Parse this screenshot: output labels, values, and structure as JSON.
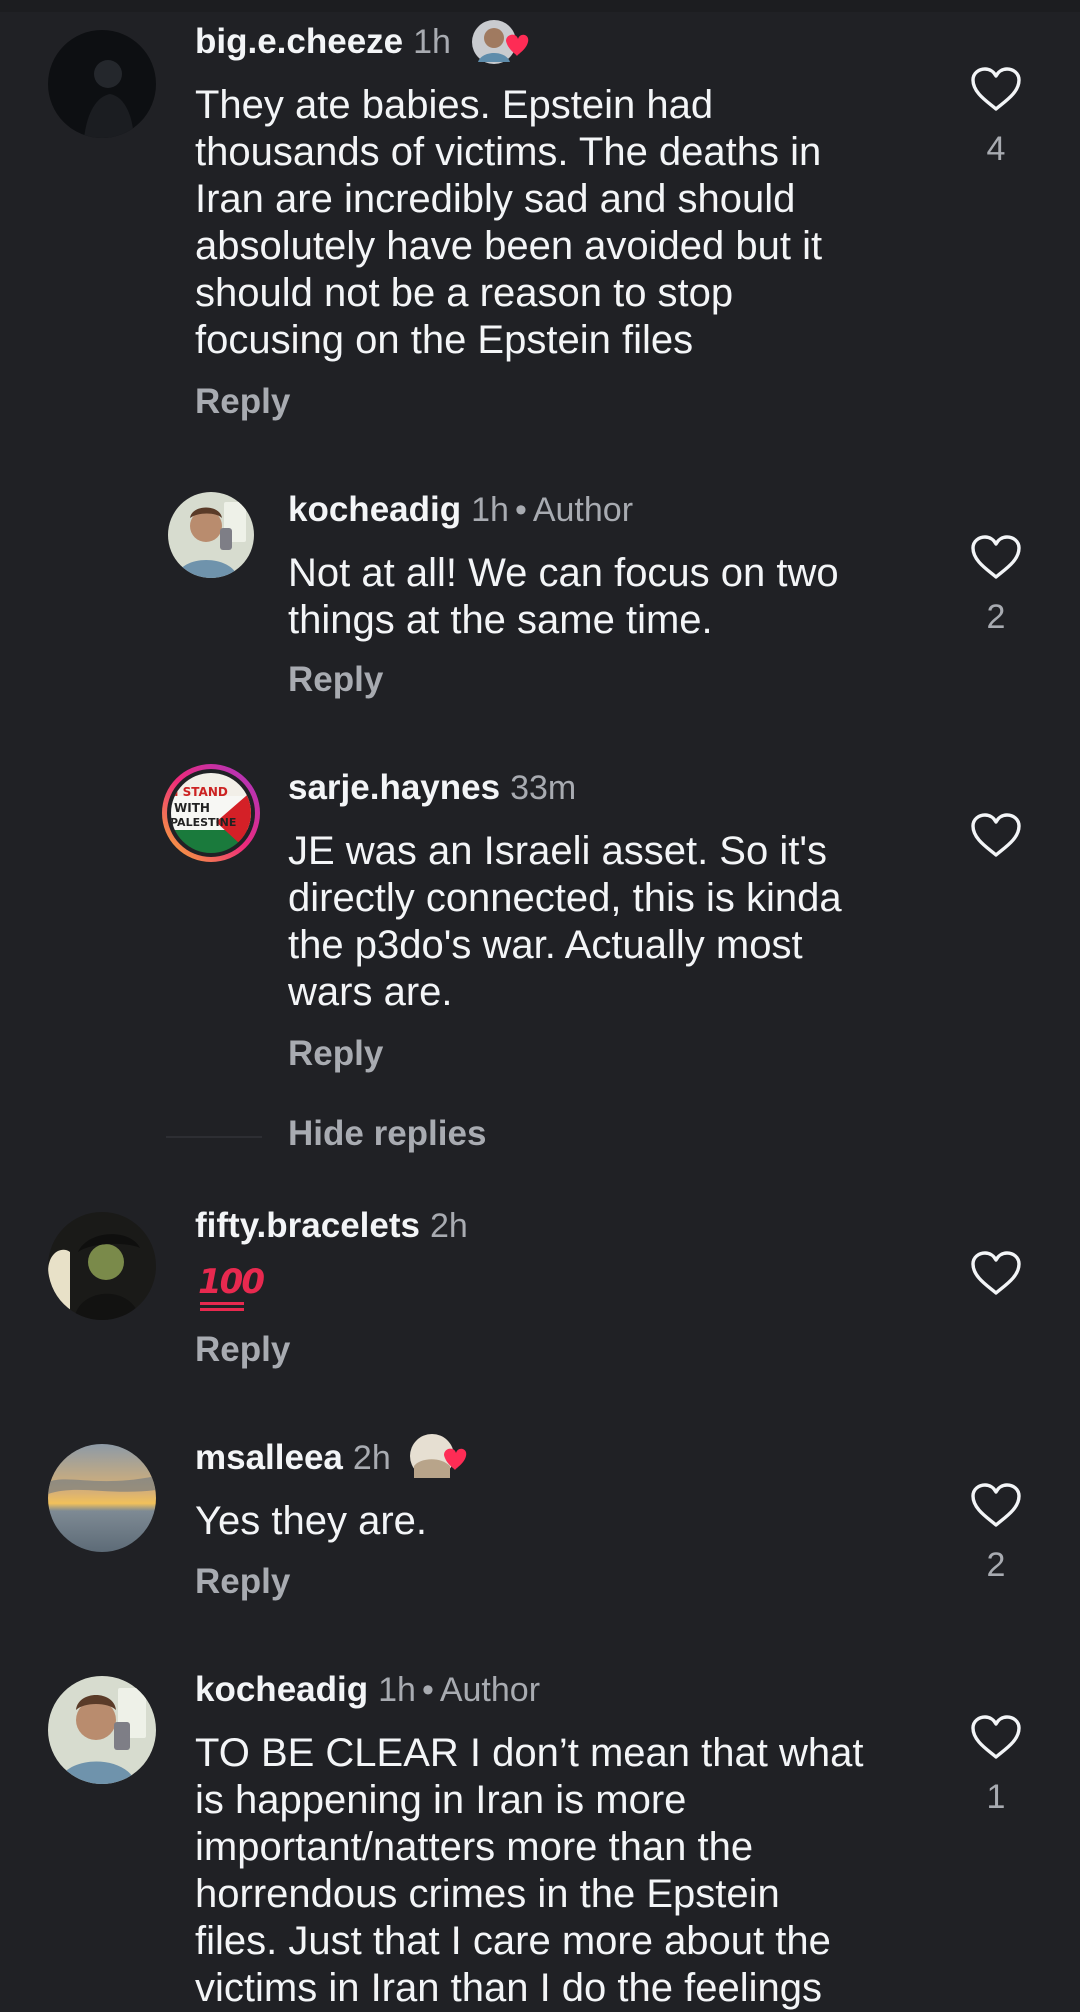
{
  "comments": [
    {
      "username": "big.e.cheeze",
      "time": "1h",
      "author_badge": "",
      "text": "They ate babies. Epstein had thousands of victims. The deaths in Iran are incredibly sad and should absolutely have been avoided but it should not be a reason to stop focusing on the Epstein files",
      "lines": [
        "They ate babies. Epstein had",
        "thousands of victims. The deaths in",
        "Iran are incredibly sad and should",
        "absolutely have been avoided but it",
        "should not be a reason to stop",
        "focusing on the Epstein files"
      ],
      "reply_label": "Reply",
      "likes": "4",
      "liked_by_author": true
    },
    {
      "username": "kocheadig",
      "time": "1h",
      "author_badge": "Author",
      "separator": "•",
      "lines": [
        "Not at all! We can focus on two",
        "things at the same time."
      ],
      "reply_label": "Reply",
      "likes": "2"
    },
    {
      "username": "sarje.haynes",
      "time": "33m",
      "avatar_text": [
        "I STAND",
        "WITH",
        "PALESTINE"
      ],
      "lines": [
        "JE was an Israeli asset. So it's",
        "directly connected, this is kinda",
        "the p3do's war. Actually most",
        "wars are."
      ],
      "reply_label": "Reply",
      "likes": ""
    },
    {
      "username": "fifty.bracelets",
      "time": "2h",
      "emoji_text": "100",
      "reply_label": "Reply",
      "likes": ""
    },
    {
      "username": "msalleea",
      "time": "2h",
      "lines": [
        "Yes they are."
      ],
      "reply_label": "Reply",
      "likes": "2",
      "liked_by_author": true
    },
    {
      "username": "kocheadig",
      "time": "1h",
      "author_badge": "Author",
      "separator": "•",
      "lines": [
        "TO BE CLEAR I don’t mean that what",
        "is happening in Iran is more",
        "important/natters more than the",
        "horrendous crimes in the Epstein",
        "files. Just that I care more about the",
        "victims in Iran than I do the feelings"
      ],
      "likes": "1"
    }
  ],
  "hide_replies_label": "Hide replies",
  "icons": {
    "like": "heart-outline-icon",
    "author_like": "author-liked-heart-icon"
  },
  "colors": {
    "background": "#202125",
    "text": "#f3f5f7",
    "secondary": "#a8abb1",
    "heart_red": "#fe2c55"
  }
}
